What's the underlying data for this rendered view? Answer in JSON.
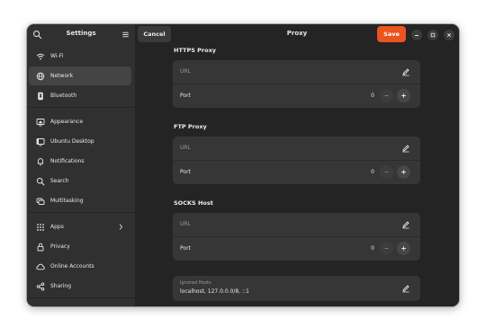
{
  "sidebar": {
    "title": "Settings",
    "items": [
      {
        "label": "Wi-Fi",
        "icon": "wifi-icon"
      },
      {
        "label": "Network",
        "icon": "network-icon",
        "active": true
      },
      {
        "label": "Bluetooth",
        "icon": "bluetooth-icon"
      },
      {
        "label": "Appearance",
        "icon": "appearance-icon"
      },
      {
        "label": "Ubuntu Desktop",
        "icon": "ubuntu-desktop-icon"
      },
      {
        "label": "Notifications",
        "icon": "bell-icon"
      },
      {
        "label": "Search",
        "icon": "search-icon"
      },
      {
        "label": "Multitasking",
        "icon": "multitasking-icon"
      },
      {
        "label": "Apps",
        "icon": "apps-grid-icon",
        "chevron": "chevron-right-icon"
      },
      {
        "label": "Privacy",
        "icon": "lock-icon"
      },
      {
        "label": "Online Accounts",
        "icon": "cloud-icon"
      },
      {
        "label": "Sharing",
        "icon": "share-icon"
      }
    ]
  },
  "header": {
    "cancel_label": "Cancel",
    "title": "Proxy",
    "save_label": "Save"
  },
  "proxy": {
    "https": {
      "title": "HTTPS Proxy",
      "url_placeholder": "URL",
      "port_label": "Port",
      "port_value": "0"
    },
    "ftp": {
      "title": "FTP Proxy",
      "url_placeholder": "URL",
      "port_label": "Port",
      "port_value": "0"
    },
    "socks": {
      "title": "SOCKS Host",
      "url_placeholder": "URL",
      "port_label": "Port",
      "port_value": "0"
    },
    "ignored": {
      "label": "Ignored Hosts",
      "value": "localhost, 127.0.0.0/8, ::1"
    }
  },
  "colors": {
    "accent": "#e95420",
    "window_bg": "#242424",
    "sidebar_bg": "#303030",
    "card_bg": "#363636"
  }
}
